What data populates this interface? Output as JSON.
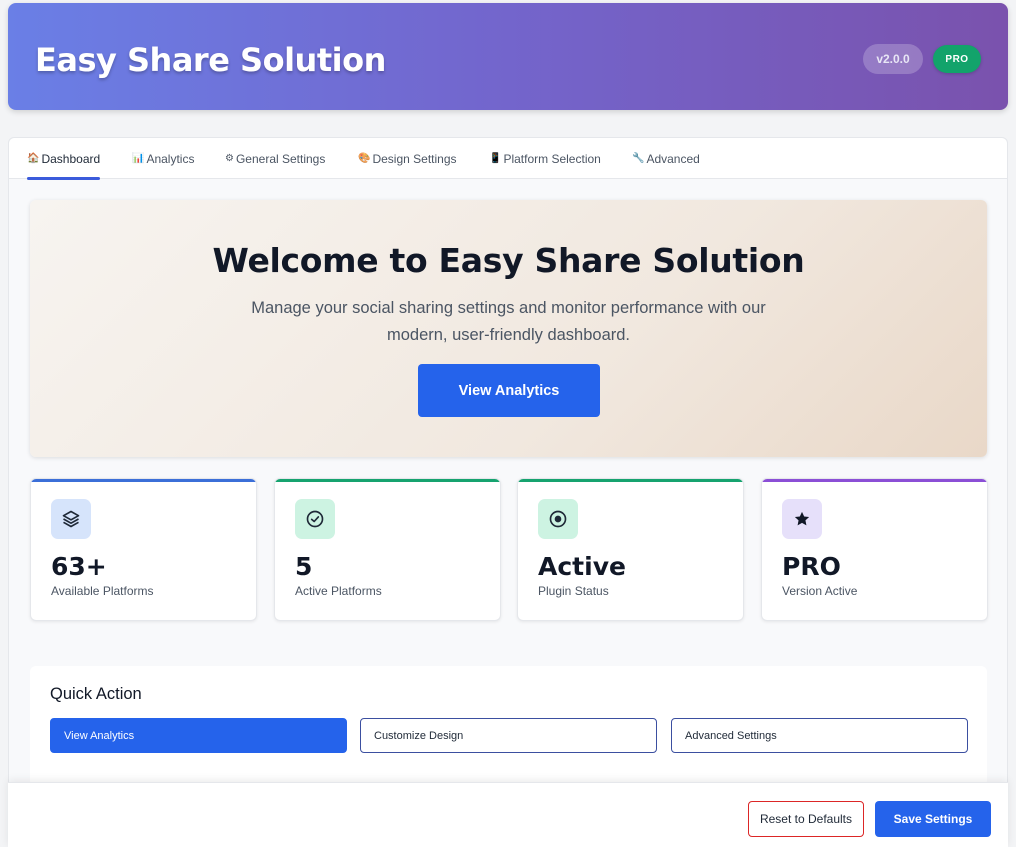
{
  "header": {
    "title": "Easy Share Solution",
    "version": "v2.0.0",
    "badge": "PRO"
  },
  "tabs": [
    {
      "icon": "house-icon",
      "glyph": "🏠",
      "label": "Dashboard",
      "active": true
    },
    {
      "icon": "chart-icon",
      "glyph": "📊",
      "label": "Analytics",
      "active": false
    },
    {
      "icon": "gear-icon",
      "glyph": "⚙",
      "label": "General Settings",
      "active": false
    },
    {
      "icon": "palette-icon",
      "glyph": "🎨",
      "label": "Design Settings",
      "active": false
    },
    {
      "icon": "phone-icon",
      "glyph": "📱",
      "label": "Platform Selection",
      "active": false
    },
    {
      "icon": "wrench-icon",
      "glyph": "🔧",
      "label": "Advanced",
      "active": false
    }
  ],
  "hero": {
    "title": "Welcome to Easy Share Solution",
    "subtitle": "Manage your social sharing settings and monitor performance with our modern, user-friendly dashboard.",
    "button": "View Analytics"
  },
  "stats": [
    {
      "icon": "layers-icon",
      "value": "63+",
      "label": "Available Platforms",
      "accent": "#3b6fd8"
    },
    {
      "icon": "check-circle-icon",
      "value": "5",
      "label": "Active Platforms",
      "accent": "#16a36f"
    },
    {
      "icon": "target-icon",
      "value": "Active",
      "label": "Plugin Status",
      "accent": "#16a36f"
    },
    {
      "icon": "star-icon",
      "value": "PRO",
      "label": "Version Active",
      "accent": "#8b4fd6"
    }
  ],
  "quick_action": {
    "title": "Quick Action",
    "buttons": [
      "View Analytics",
      "Customize Design",
      "Advanced Settings"
    ]
  },
  "footer": {
    "reset": "Reset to Defaults",
    "save": "Save Settings"
  },
  "colors": {
    "primary": "#2563eb",
    "success": "#12a36b",
    "danger": "#dc2626",
    "header_gradient_start": "#6a7fe6",
    "header_gradient_end": "#7a52ad"
  }
}
